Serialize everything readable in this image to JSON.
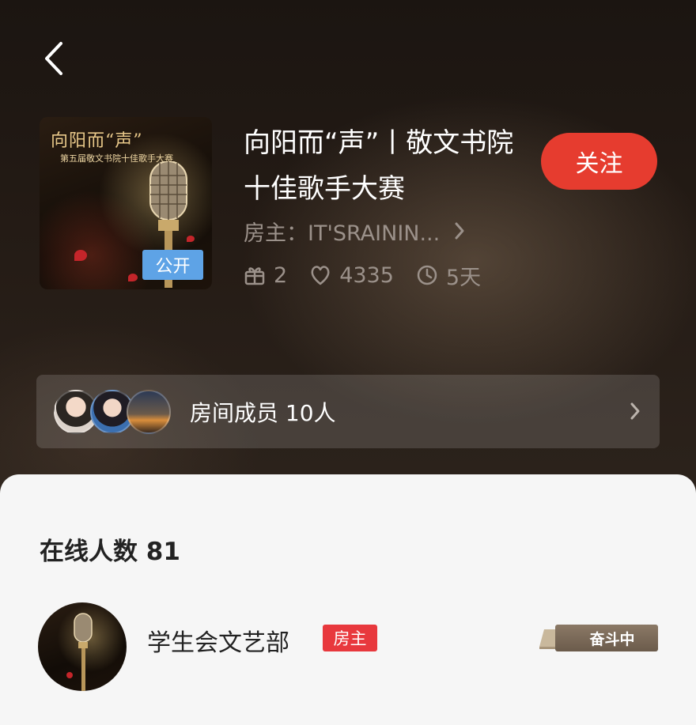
{
  "header": {
    "cover": {
      "title": "向阳而“声”",
      "subtitle": "第五届敬文书院十佳歌手大赛",
      "visibility_badge": "公开"
    },
    "room_title": "向阳而“声”丨敬文书院十佳歌手大赛",
    "follow_label": "关注",
    "host_label": "房主：IT'SRAININ...",
    "stats": {
      "gifts": "2",
      "popularity": "4335",
      "duration": "5天"
    }
  },
  "members": {
    "label": "房间成员 10人"
  },
  "online": {
    "title": "在线人数 81",
    "users": [
      {
        "name": "学生会文艺部",
        "role_tag": "房主",
        "level_badge": "奋斗中"
      }
    ]
  },
  "colors": {
    "accent": "#e63c2f",
    "public_badge": "#5ea3e6",
    "owner_tag": "#e8383d"
  },
  "icons": [
    "back-arrow-icon",
    "chevron-right-icon",
    "gift-icon",
    "heart-icon",
    "clock-icon",
    "microphone-icon"
  ]
}
